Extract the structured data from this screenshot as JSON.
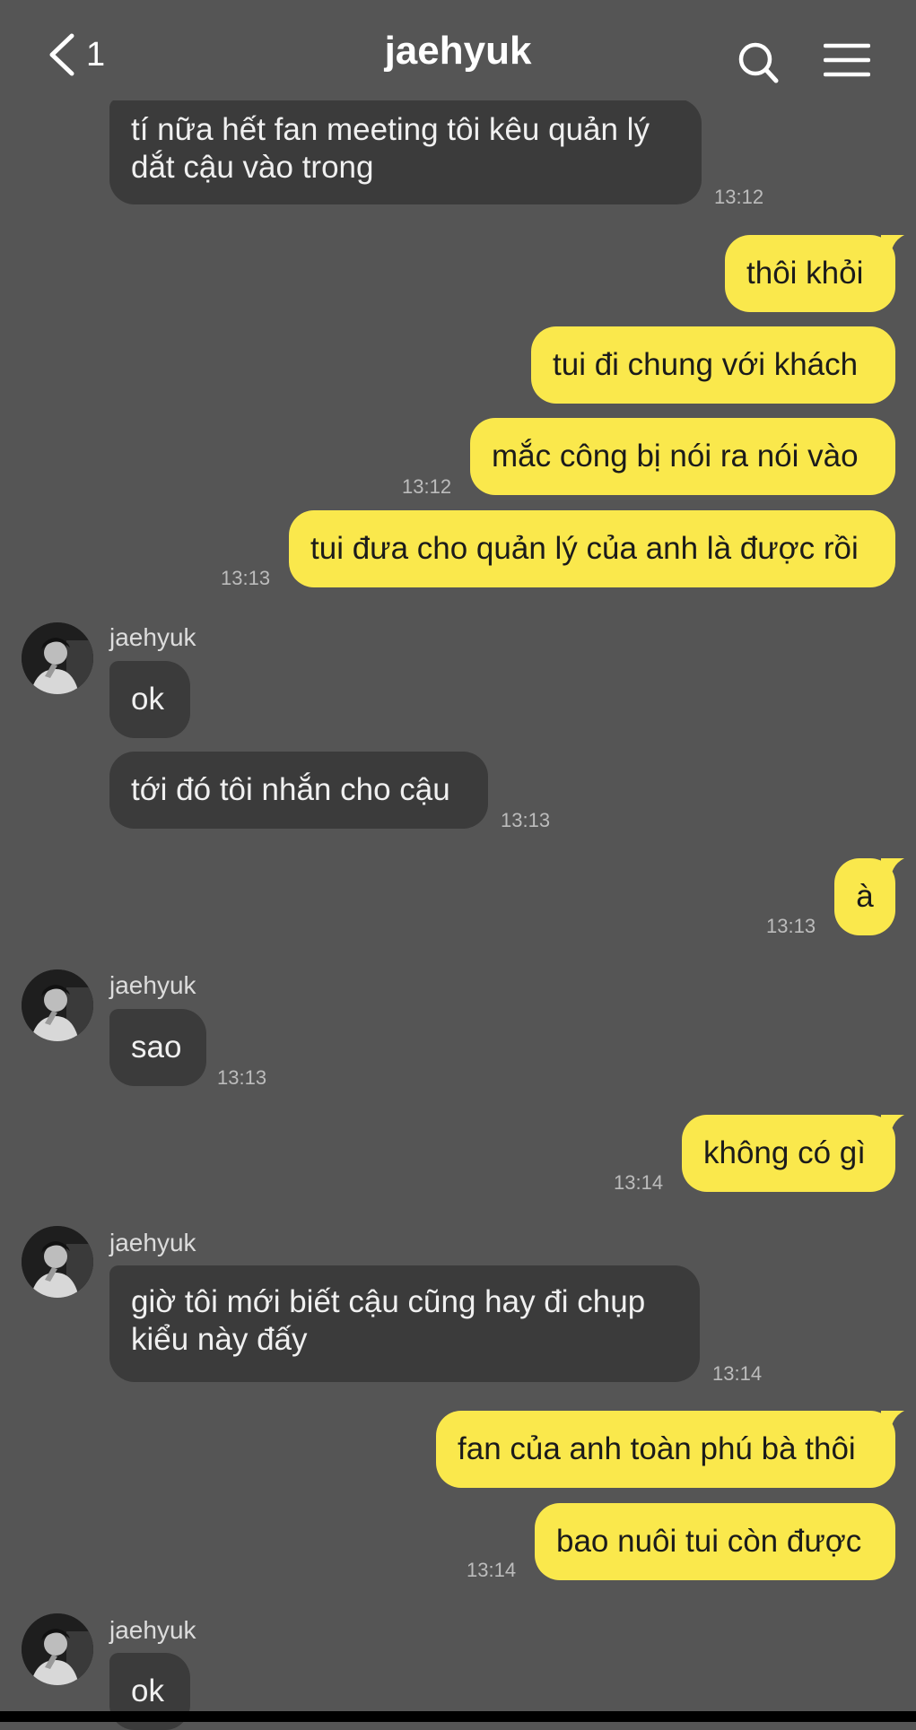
{
  "header": {
    "title": "jaehyuk",
    "unread_count": "1"
  },
  "messages": [
    {
      "id": "m1",
      "from": "them",
      "text": "tí nữa hết fan meeting tôi kêu quản lý\ndắt cậu vào trong",
      "time": "13:12"
    },
    {
      "id": "m2",
      "from": "me",
      "text": "thôi khỏi",
      "time": ""
    },
    {
      "id": "m3",
      "from": "me",
      "text": "tui đi chung với khách",
      "time": ""
    },
    {
      "id": "m4",
      "from": "me",
      "text": "mắc công bị nói ra nói vào",
      "time": "13:12"
    },
    {
      "id": "m5",
      "from": "me",
      "text": "tui đưa cho quản lý của anh là được rồi",
      "time": "13:13"
    },
    {
      "id": "m6",
      "from": "them",
      "sender": "jaehyuk",
      "text": "ok",
      "time": ""
    },
    {
      "id": "m7",
      "from": "them",
      "text": "tới đó tôi nhắn cho cậu",
      "time": "13:13"
    },
    {
      "id": "m8",
      "from": "me",
      "text": "à",
      "time": "13:13"
    },
    {
      "id": "m9",
      "from": "them",
      "sender": "jaehyuk",
      "text": "sao",
      "time": "13:13"
    },
    {
      "id": "m10",
      "from": "me",
      "text": "không có gì",
      "time": "13:14"
    },
    {
      "id": "m11",
      "from": "them",
      "sender": "jaehyuk",
      "text": "giờ tôi mới biết cậu cũng hay đi chụp\nkiểu này đấy",
      "time": "13:14"
    },
    {
      "id": "m12",
      "from": "me",
      "text": "fan của anh toàn phú bà thôi",
      "time": ""
    },
    {
      "id": "m13",
      "from": "me",
      "text": "bao nuôi tui còn được",
      "time": "13:14"
    },
    {
      "id": "m14",
      "from": "them",
      "sender": "jaehyuk",
      "text": "ok",
      "time": ""
    }
  ],
  "colors": {
    "background": "#555555",
    "incoming_bubble": "#3b3b3b",
    "outgoing_bubble": "#fae84c"
  },
  "icons": {
    "back": "chevron-left-icon",
    "search": "search-icon",
    "menu": "hamburger-menu-icon",
    "avatar": "profile-photo"
  }
}
